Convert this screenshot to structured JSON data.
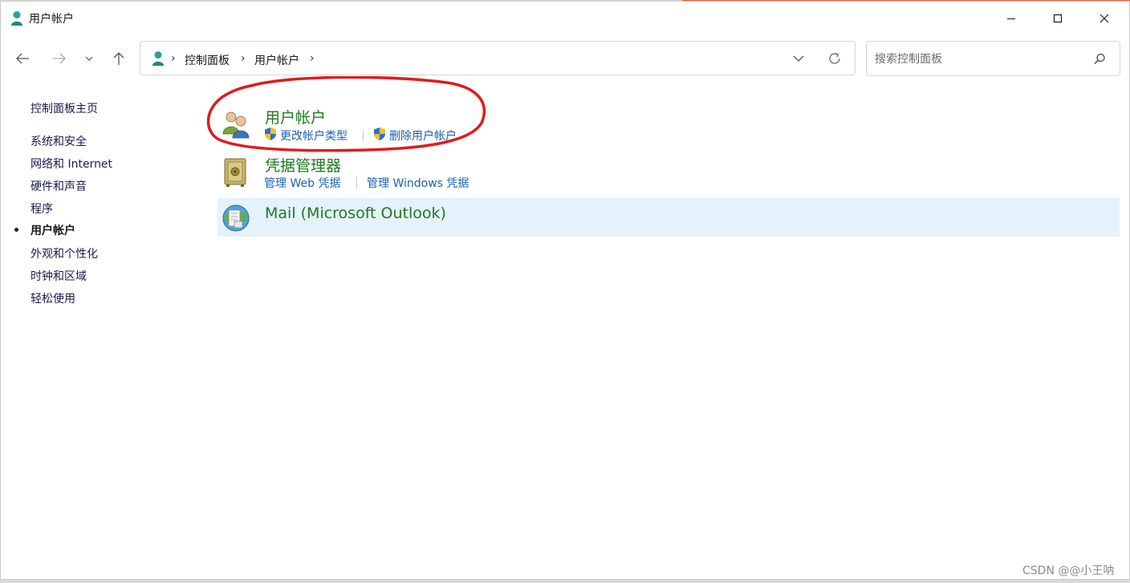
{
  "window": {
    "title": "用户帐户",
    "controls": [
      "minimize",
      "maximize",
      "close"
    ]
  },
  "navigation": {
    "breadcrumbs": [
      "控制面板",
      "用户帐户"
    ],
    "search_placeholder": "搜索控制面板"
  },
  "sidebar": {
    "home_link": "控制面板主页",
    "items": [
      {
        "label": "系统和安全",
        "active": false
      },
      {
        "label": "网络和 Internet",
        "active": false
      },
      {
        "label": "硬件和声音",
        "active": false
      },
      {
        "label": "程序",
        "active": false
      },
      {
        "label": "用户帐户",
        "active": true
      },
      {
        "label": "外观和个性化",
        "active": false
      },
      {
        "label": "时钟和区域",
        "active": false
      },
      {
        "label": "轻松使用",
        "active": false
      }
    ]
  },
  "content": {
    "sections": [
      {
        "title": "用户帐户",
        "icon": "users-icon",
        "links": [
          "更改帐户类型",
          "删除用户帐户"
        ],
        "annotated": true
      },
      {
        "title": "凭据管理器",
        "icon": "vault-icon",
        "links": [
          "管理 Web 凭据",
          "管理 Windows 凭据"
        ]
      },
      {
        "title": "Mail (Microsoft Outlook)",
        "icon": "mail-globe-icon",
        "links": [],
        "highlighted": true
      }
    ]
  },
  "colors": {
    "section_title": "#1e7a1e",
    "link": "#1d5fb8",
    "highlight_bg": "#e5f1fb",
    "annotation": "#e01b1b"
  },
  "watermark": "CSDN @@小王呐"
}
